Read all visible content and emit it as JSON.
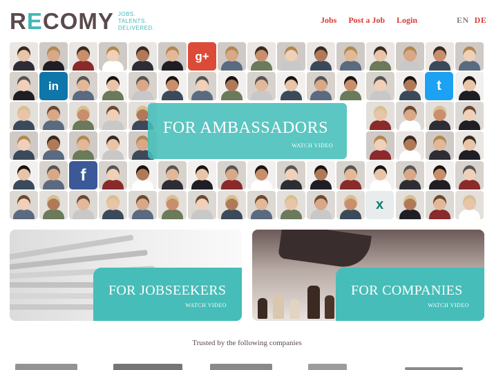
{
  "header": {
    "logo_text_pre": "R",
    "logo_text_e": "E",
    "logo_text_post": "COMY",
    "tagline": [
      "JOBS.",
      "TALENTS.",
      "DELIVERED."
    ],
    "nav": [
      "Jobs",
      "Post a Job",
      "Login"
    ],
    "languages": [
      "EN",
      "DE"
    ]
  },
  "hero": {
    "title": "FOR AMBASSADORS",
    "watch": "WATCH VIDEO",
    "social_icons": [
      "linkedin-icon",
      "google-plus-icon",
      "twitter-icon",
      "facebook-icon",
      "xing-icon"
    ]
  },
  "cards": {
    "jobseekers": {
      "title": "FOR JOBSEEKERS",
      "watch": "WATCH VIDEO"
    },
    "companies": {
      "title": "FOR COMPANIES",
      "watch": "WATCH VIDEO"
    }
  },
  "trusted": {
    "text": "Trusted by the following companies"
  },
  "colors": {
    "accent": "#46bdb8",
    "nav_red": "#d83a34",
    "logo_dark": "#5a4a4d"
  }
}
